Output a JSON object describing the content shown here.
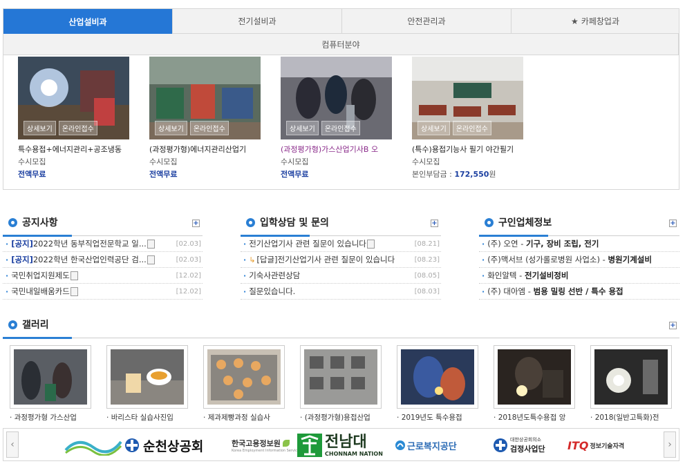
{
  "tabs": {
    "row1": [
      "산업설비과",
      "전기설비과",
      "안전관리과",
      "카페창업과"
    ],
    "row2": [
      "컴퓨터분야"
    ],
    "active_index": 0
  },
  "course_buttons": {
    "detail": "상세보기",
    "apply": "온라인접수"
  },
  "courses": [
    {
      "title": "특수용접+에너지관리+공조냉동",
      "sub": "수시모집",
      "price": "전액무료"
    },
    {
      "title": "(과정평가형)에너지관리산업기",
      "sub": "수시모집",
      "price": "전액무료"
    },
    {
      "title": "(과정평가형)가스산업기사B 오",
      "sub": "수시모집",
      "price": "전액무료"
    },
    {
      "title": "(특수)용접기능사 필기 야간필기",
      "sub": "수시모집",
      "price_label": "본인부담금 : ",
      "price_value": "172,550",
      "price_unit": "원"
    }
  ],
  "notice": {
    "title": "공지사항",
    "items": [
      {
        "tag": "[공지]",
        "text": "2022학년 동부직업전문학교 일...",
        "date": "[02.03]",
        "file": true
      },
      {
        "tag": "[공지]",
        "text": "2022학년 한국산업인력공단 검...",
        "date": "[02.03]",
        "file": true
      },
      {
        "tag": "",
        "text": "국민취업지원제도",
        "date": "[12.02]",
        "file": true
      },
      {
        "tag": "",
        "text": "국민내일배움카드",
        "date": "[12.02]",
        "file": true
      }
    ]
  },
  "qna": {
    "title": "입학상담 및 문의",
    "items": [
      {
        "text": "전기산업기사 관련 질문이 있습니다",
        "date": "[08.21]",
        "file": true,
        "reply": false
      },
      {
        "text": "[답글]전기산업기사 관련 질문이 있습니다",
        "date": "[08.23]",
        "file": false,
        "reply": true
      },
      {
        "text": "기숙사관련상담",
        "date": "[08.05]",
        "file": false,
        "reply": false
      },
      {
        "text": "질문있습니다.",
        "date": "[08.03]",
        "file": false,
        "reply": false
      }
    ]
  },
  "jobs": {
    "title": "구인업체정보",
    "items": [
      {
        "company": "(주) 오연",
        "job": "기구, 장비 조립, 전기"
      },
      {
        "company": "(주)맥서브 (성가롤로병원 사업소)",
        "job": "병원기계설비"
      },
      {
        "company": "화인알텍",
        "job": "전기설비정비"
      },
      {
        "company": "(주) 대아엠",
        "job": "범용 밀링 선반 / 특수 용접"
      }
    ]
  },
  "gallery": {
    "title": "갤러리",
    "items": [
      "과정평가형 가스산업",
      "바리스타 실습사진입",
      "제과제빵과정 실습사",
      "(과정평가형)용접산업",
      "2019년도 특수용접",
      "2018년도특수용접 앙",
      "2018(일반고특화)전"
    ]
  },
  "partners": {
    "logos": [
      {
        "name": "순천상공회",
        "sub": ""
      },
      {
        "name": "한국고용정보원",
        "sub": "Korea Employment Information Service"
      },
      {
        "name": "전남대",
        "sub": "CHONNAM NATION"
      },
      {
        "name": "근로복지공단",
        "sub": ""
      },
      {
        "name": "검정사업단",
        "sub": "대한상공회의소"
      },
      {
        "name": "ITQ",
        "sub": "정보기술자격"
      }
    ]
  },
  "plus_symbol": "+",
  "colors": {
    "accent": "#2577d6",
    "dark_blue": "#1b3fa0"
  }
}
